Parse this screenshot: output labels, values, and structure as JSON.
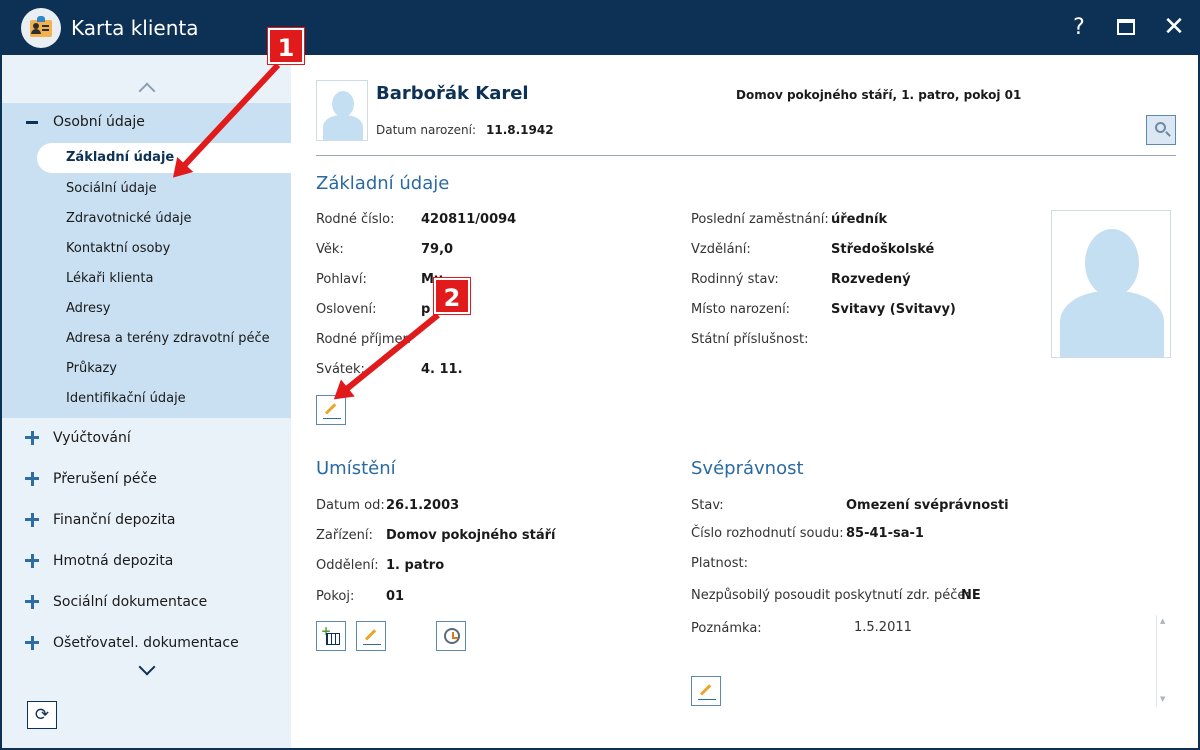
{
  "window": {
    "title": "Karta klienta",
    "help": "?",
    "maximize": "□",
    "close": "✕"
  },
  "sidebar": {
    "expanded_group": "Osobní údaje",
    "subitems": [
      "Základní údaje",
      "Sociální údaje",
      "Zdravotnické údaje",
      "Kontaktní osoby",
      "Lékaři klienta",
      "Adresy",
      "Adresa a terény zdravotní péče",
      "Průkazy",
      "Identifikační údaje"
    ],
    "groups": [
      "Vyúčtování",
      "Přerušení péče",
      "Finanční depozita",
      "Hmotná depozita",
      "Sociální dokumentace",
      "Ošetřovatel. dokumentace"
    ],
    "refresh": "⟳"
  },
  "client": {
    "name": "Barbořák Karel",
    "dob_label": "Datum narození:",
    "dob": "11.8.1942",
    "location": "Domov pokojného stáří, 1. patro, pokoj 01"
  },
  "basic": {
    "title": "Základní údaje",
    "left": [
      {
        "label": "Rodné číslo:",
        "value": "420811/0094"
      },
      {
        "label": "Věk:",
        "value": "79,0"
      },
      {
        "label": "Pohlaví:",
        "value": "Mu"
      },
      {
        "label": "Oslovení:",
        "value": "p"
      },
      {
        "label": "Rodné příjmen",
        "value": ""
      },
      {
        "label": "Svátek:",
        "value": "4. 11."
      }
    ],
    "right": [
      {
        "label": "Poslední zaměstnání:",
        "value": "úředník"
      },
      {
        "label": "Vzdělání:",
        "value": "Středoškolské"
      },
      {
        "label": "Rodinný stav:",
        "value": "Rozvedený"
      },
      {
        "label": "Místo narození:",
        "value": "Svitavy (Svitavy)"
      },
      {
        "label": "Státní příslušnost:",
        "value": ""
      }
    ]
  },
  "placement": {
    "title": "Umístění",
    "rows": [
      {
        "label": "Datum od:",
        "value": "26.1.2003"
      },
      {
        "label": "Zařízení:",
        "value": "Domov pokojného stáří"
      },
      {
        "label": "Oddělení:",
        "value": "1. patro"
      },
      {
        "label": "Pokoj:",
        "value": "01"
      }
    ]
  },
  "capacity": {
    "title": "Svéprávnost",
    "rows": [
      {
        "label": "Stav:",
        "value": "Omezení svéprávnosti"
      },
      {
        "label": "Číslo rozhodnutí soudu:",
        "value": "85-41-sa-1"
      },
      {
        "label": "Platnost:",
        "value": ""
      },
      {
        "label": "Nezpůsobilý posoudit poskytnutí zdr. péče:",
        "value": "NE"
      },
      {
        "label": "Poznámka:",
        "value": "1.5.2011"
      }
    ]
  },
  "annotations": {
    "badge1": "1",
    "badge2": "2",
    "color": "#e11b1b"
  }
}
